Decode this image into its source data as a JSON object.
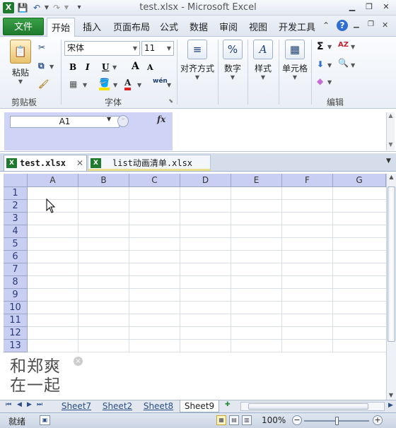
{
  "window": {
    "title": "test.xlsx - Microsoft Excel",
    "app_logo": "X",
    "quick_access": [
      "save-icon",
      "undo-icon",
      "redo-icon",
      "customize-icon"
    ]
  },
  "ribbon_tabs": [
    "文件",
    "开始",
    "插入",
    "页面布局",
    "公式",
    "数据",
    "审阅",
    "视图",
    "开发工具"
  ],
  "active_tab": "开始",
  "ribbon": {
    "clipboard": {
      "paste": "粘贴",
      "label": "剪贴板"
    },
    "font": {
      "name": "宋体",
      "size": "11",
      "bold": "B",
      "italic": "I",
      "underline": "U",
      "grow": "A",
      "shrink": "A",
      "color_a": "A",
      "phonetic": "wén",
      "label": "字体"
    },
    "alignment": {
      "label": "对齐方式"
    },
    "number": {
      "label": "数字",
      "icon_text": "%"
    },
    "styles": {
      "label": "样式",
      "icon_text": "A"
    },
    "cells": {
      "label": "单元格"
    },
    "editing": {
      "label": "编辑",
      "sum": "Σ",
      "sort": "AZ",
      "find": "🔍"
    }
  },
  "formula_bar": {
    "name_box": "A1",
    "fx": "fx",
    "value": ""
  },
  "workbooks": [
    {
      "name": "test.xlsx",
      "close": "✕"
    },
    {
      "name": "list动画清单.xlsx"
    }
  ],
  "grid": {
    "columns": [
      "A",
      "B",
      "C",
      "D",
      "E",
      "F",
      "G"
    ],
    "rows": [
      "1",
      "2",
      "3",
      "4",
      "5",
      "6",
      "7",
      "8",
      "9",
      "10",
      "11",
      "12",
      "13"
    ]
  },
  "watermark": {
    "line1": "和郑爽",
    "line2": "在一起",
    "close": "×"
  },
  "sheets": [
    "Sheet7",
    "Sheet2",
    "Sheet8",
    "Sheet9"
  ],
  "active_sheet": "Sheet9",
  "status": {
    "text": "就绪",
    "zoom": "100%",
    "zoom_level": 100
  },
  "colors": {
    "file_tab": "#1e7a2c",
    "header_fill": "#c9cff2",
    "ribbon_bg": "#e9eef5"
  }
}
